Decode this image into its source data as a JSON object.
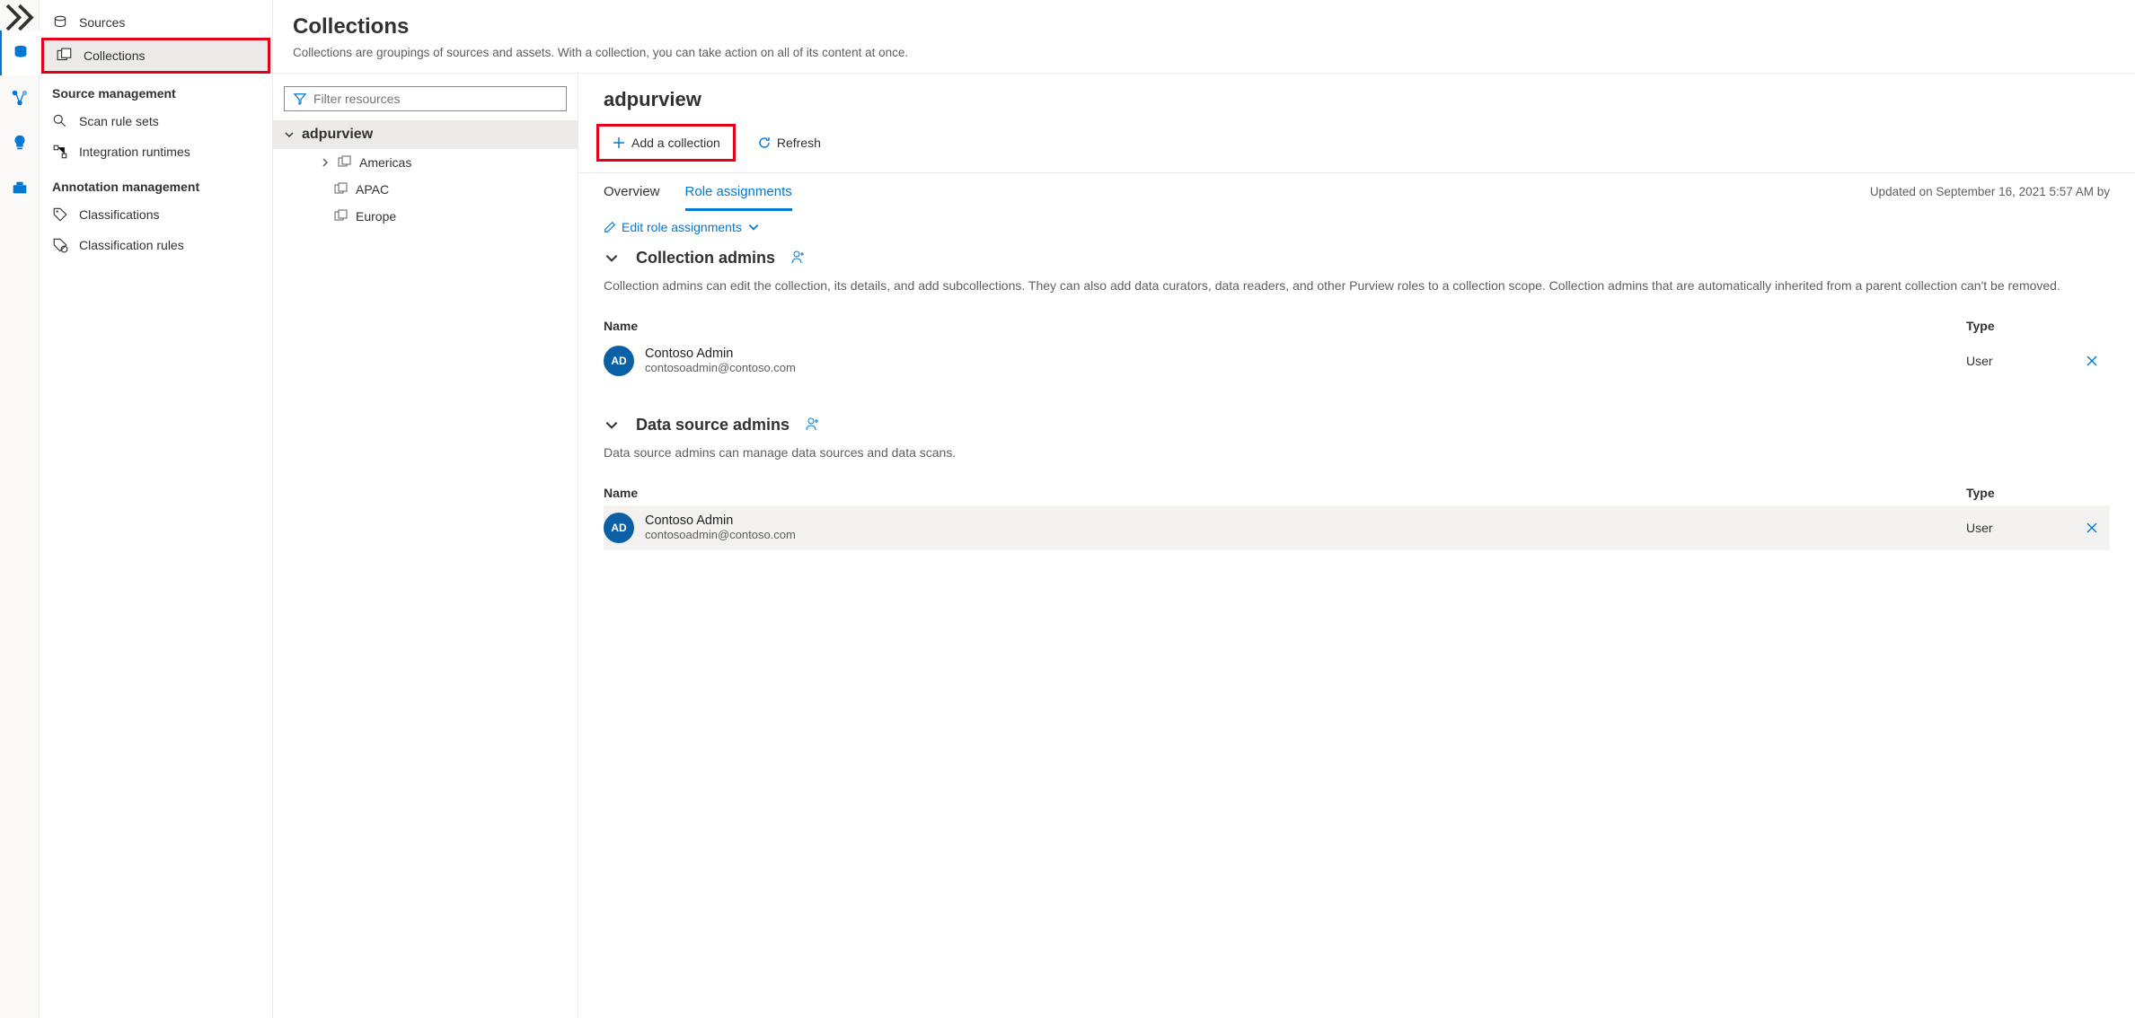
{
  "sidebar": {
    "items": [
      {
        "label": "Sources",
        "icon": "sources"
      },
      {
        "label": "Collections",
        "icon": "collections",
        "selected": true
      }
    ],
    "source_management_heading": "Source management",
    "source_management": [
      {
        "label": "Scan rule sets"
      },
      {
        "label": "Integration runtimes"
      }
    ],
    "annotation_management_heading": "Annotation management",
    "annotation_management": [
      {
        "label": "Classifications"
      },
      {
        "label": "Classification rules"
      }
    ]
  },
  "header": {
    "title": "Collections",
    "subtitle": "Collections are groupings of sources and assets. With a collection, you can take action on all of its content at once."
  },
  "filter_placeholder": "Filter resources",
  "tree": {
    "root": "adpurview",
    "children": [
      {
        "label": "Americas",
        "has_children": true
      },
      {
        "label": "APAC",
        "has_children": false
      },
      {
        "label": "Europe",
        "has_children": false
      }
    ]
  },
  "main": {
    "title": "adpurview",
    "toolbar": {
      "add_collection": "Add a collection",
      "refresh": "Refresh"
    },
    "tabs": {
      "overview": "Overview",
      "role_assignments": "Role assignments"
    },
    "updated_text": "Updated on September 16, 2021 5:57 AM by",
    "edit_role_assignments": "Edit role assignments",
    "roles": [
      {
        "title": "Collection admins",
        "desc": "Collection admins can edit the collection, its details, and add subcollections. They can also add data curators, data readers, and other Purview roles to a collection scope. Collection admins that are automatically inherited from a parent collection can't be removed.",
        "members": [
          {
            "initials": "AD",
            "name": "Contoso Admin",
            "email": "contosoadmin@contoso.com",
            "type": "User"
          }
        ],
        "shaded": false
      },
      {
        "title": "Data source admins",
        "desc": "Data source admins can manage data sources and data scans.",
        "members": [
          {
            "initials": "AD",
            "name": "Contoso Admin",
            "email": "contosoadmin@contoso.com",
            "type": "User"
          }
        ],
        "shaded": true
      }
    ],
    "table_headers": {
      "name": "Name",
      "type": "Type"
    }
  }
}
